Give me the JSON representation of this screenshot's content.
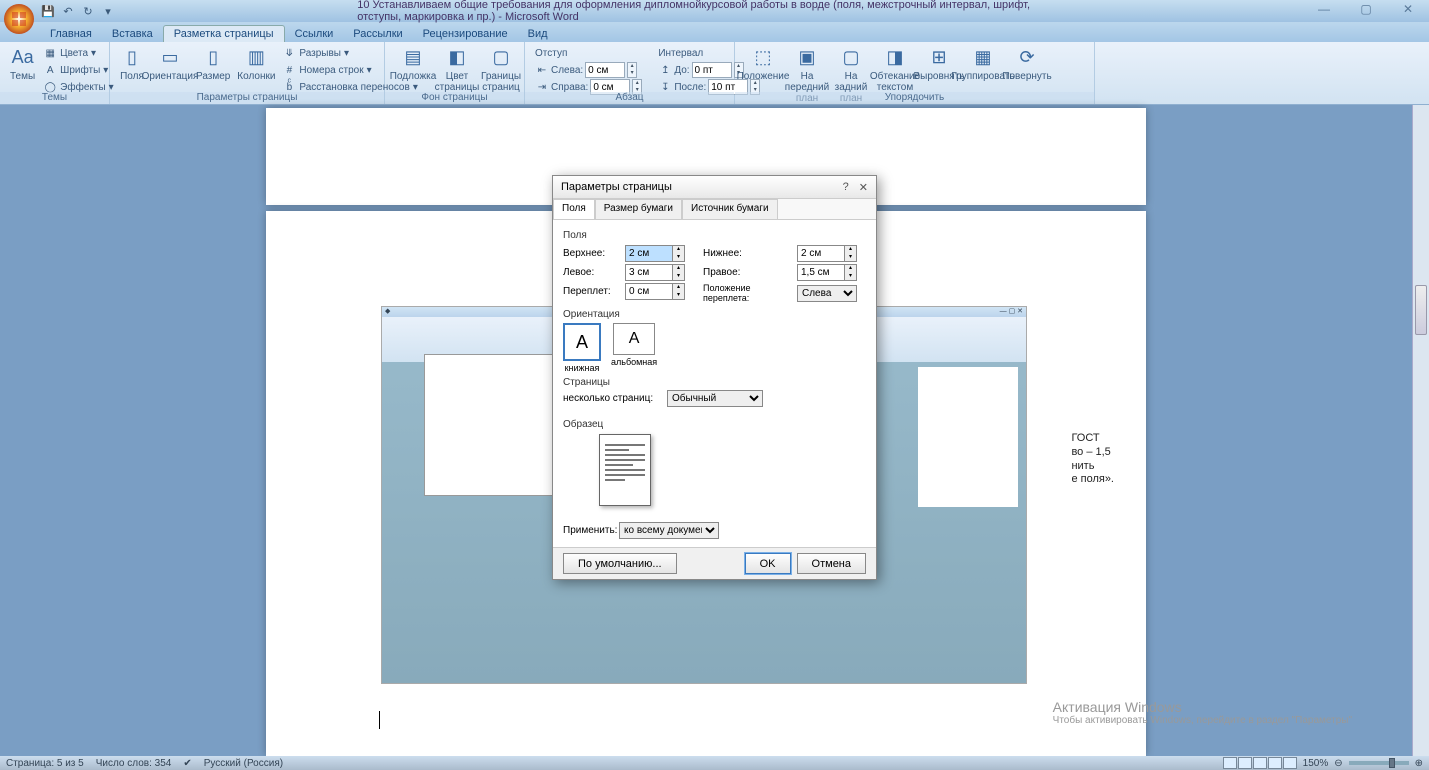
{
  "title": "10 Устанавливаем общие требования для оформления дипломнойкурсовой работы в ворде (поля, межстрочный интервал, шрифт, отступы, маркировка и пр.) - Microsoft Word",
  "tabs": [
    "Главная",
    "Вставка",
    "Разметка страницы",
    "Ссылки",
    "Рассылки",
    "Рецензирование",
    "Вид"
  ],
  "active_tab": 2,
  "ribbon": {
    "themes": {
      "label": "Темы",
      "big": "Темы",
      "items": [
        "Цвета",
        "Шрифты",
        "Эффекты"
      ]
    },
    "page_setup": {
      "label": "Параметры страницы",
      "big": [
        "Поля",
        "Ориентация",
        "Размер",
        "Колонки"
      ],
      "items": [
        "Разрывы",
        "Номера строк",
        "Расстановка переносов"
      ]
    },
    "page_bg": {
      "label": "Фон страницы",
      "big": [
        "Подложка",
        "Цвет страницы",
        "Границы страниц"
      ]
    },
    "paragraph": {
      "label": "Абзац",
      "indent_label": "Отступ",
      "spacing_label": "Интервал",
      "left_l": "Слева:",
      "left_v": "0 см",
      "right_l": "Справа:",
      "right_v": "0 см",
      "before_l": "До:",
      "before_v": "0 пт",
      "after_l": "После:",
      "after_v": "10 пт"
    },
    "arrange": {
      "label": "Упорядочить",
      "big": [
        "Положение",
        "На передний план",
        "На задний план",
        "Обтекание текстом",
        "Выровнять",
        "Группировать",
        "Повернуть"
      ]
    }
  },
  "dialog": {
    "title": "Параметры страницы",
    "tabs": [
      "Поля",
      "Размер бумаги",
      "Источник бумаги"
    ],
    "active_tab": 0,
    "sect_margins": "Поля",
    "top_l": "Верхнее:",
    "top_v": "2 см",
    "bottom_l": "Нижнее:",
    "bottom_v": "2 см",
    "left_l": "Левое:",
    "left_v": "3 см",
    "right_l": "Правое:",
    "right_v": "1,5 см",
    "gutter_l": "Переплет:",
    "gutter_v": "0 см",
    "gutter_pos_l": "Положение переплета:",
    "gutter_pos_v": "Слева",
    "sect_orient": "Ориентация",
    "orient_portrait": "книжная",
    "orient_landscape": "альбомная",
    "sect_pages": "Страницы",
    "multi_l": "несколько страниц:",
    "multi_v": "Обычный",
    "sect_preview": "Образец",
    "apply_l": "Применить:",
    "apply_v": "ко всему документу",
    "default_btn": "По умолчанию...",
    "ok": "OK",
    "cancel": "Отмена"
  },
  "doc_text": [
    "ГОСТ",
    "во – 1,5",
    "нить",
    "е поля»."
  ],
  "watermark": {
    "title": "Активация Windows",
    "sub": "Чтобы активировать Windows, перейдите в раздел \"Параметры\""
  },
  "status": {
    "page": "Страница: 5 из 5",
    "words": "Число слов: 354",
    "lang": "Русский (Россия)",
    "zoom": "150%"
  }
}
